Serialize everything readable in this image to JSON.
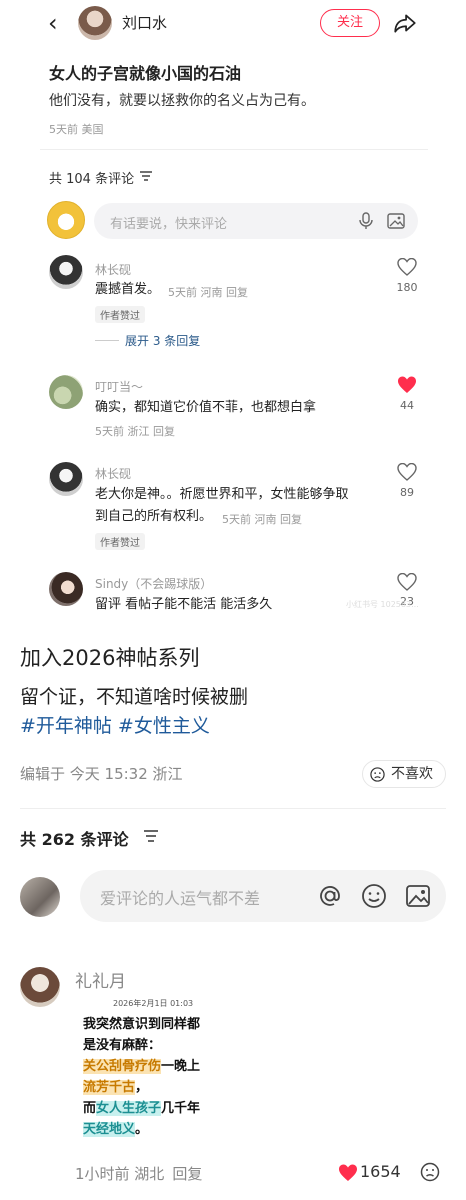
{
  "colors": {
    "accent": "#ff2e4d",
    "tag_blue": "#1f5a9a",
    "like_red": "#ff2e4d"
  },
  "embedded": {
    "author_name": "刘口水",
    "follow_label": "关注",
    "note_title": "女人的子宫就像小国的石油",
    "note_body": "他们没有，就要以拯救你的名义占为己有。",
    "note_meta": "5天前 美国",
    "comment_count": "共 104 条评论",
    "input_placeholder": "有话要说，快来评论",
    "expand_replies": "展开 3 条回复",
    "watermark": "小红书号 102583...",
    "comments": [
      {
        "name": "林长砚",
        "text": "震撼首发。",
        "meta": "5天前 河南 回复",
        "badge": "作者赞过",
        "likes": "180",
        "liked": false
      },
      {
        "name": "叮叮当～",
        "text": "确实，都知道它价值不菲，也都想白拿",
        "meta": "5天前 浙江 回复",
        "likes": "44",
        "liked": true
      },
      {
        "name": "林长砚",
        "text_line1": "老大你是神。。祈愿世界和平，女性能够争取",
        "text_line2": "到自己的所有权利。",
        "meta": "5天前 河南 回复",
        "badge": "作者赞过",
        "likes": "89",
        "liked": false
      },
      {
        "name": "Sindy（不会踢球版）",
        "text": "留评 看帖子能不能活 能活多久",
        "likes": "23",
        "liked": false
      }
    ]
  },
  "post": {
    "title": "加入2026神帖系列",
    "body": "留个证，不知道啥时候被删",
    "tags": [
      "#开年神帖",
      "#女性主义"
    ],
    "meta": "编辑于 今天 15:32 浙江",
    "dislike_label": "不喜欢",
    "total_comments": "共 262 条评论",
    "comment_placeholder": "爱评论的人运气都不差"
  },
  "top_comment": {
    "name": "礼礼月",
    "image": {
      "date": "2026年2月1日 01:03",
      "lines": [
        "我突然意识到同样都",
        "是没有麻醉："
      ],
      "hl1": "关公刮骨疗伤",
      "after_hl1": "一晚上",
      "hl2": "流芳千古",
      "after_hl2": "，",
      "prefix3": "而",
      "hl3": "女人生孩子",
      "after_hl3": "几千年",
      "hl4": "天经地义",
      "after_hl4": "。"
    },
    "meta_time": "1小时前 湖北",
    "reply": "回复",
    "likes": "1654"
  }
}
